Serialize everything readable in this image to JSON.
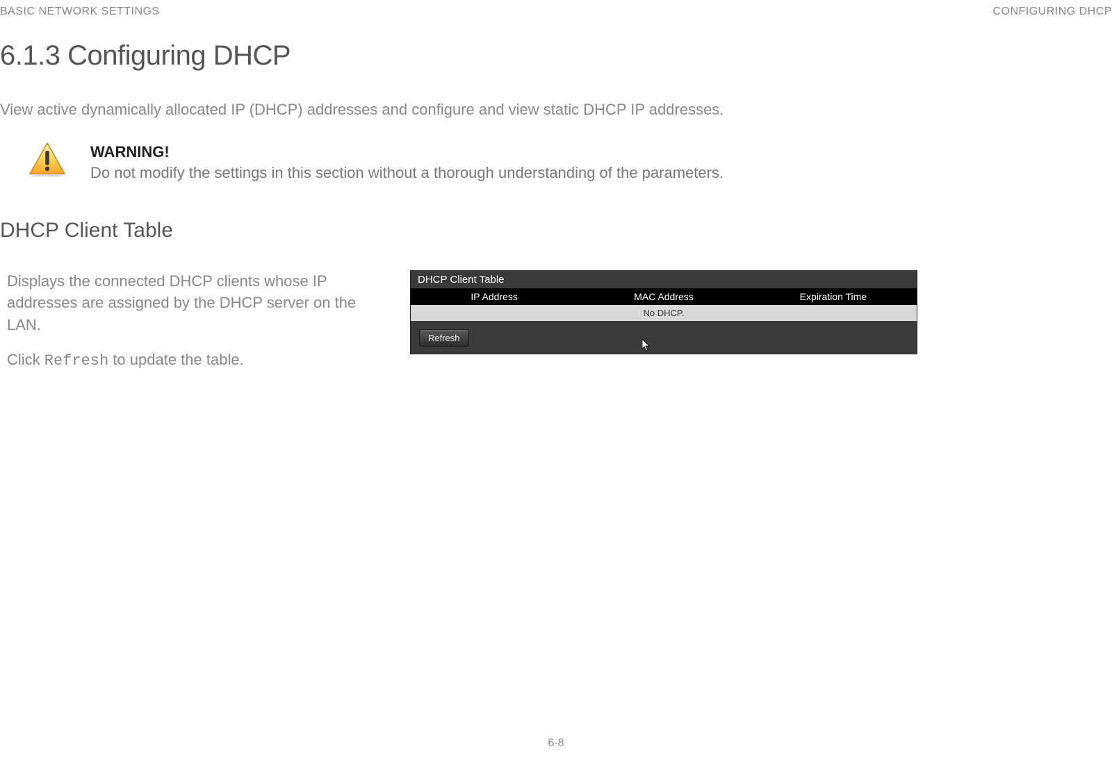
{
  "header": {
    "left": "BASIC NETWORK SETTINGS",
    "right": "CONFIGURING DHCP"
  },
  "section_title": "6.1.3 Configuring DHCP",
  "intro": "View active dynamically allocated IP (DHCP) addresses and configure and view static DHCP IP addresses.",
  "warning": {
    "label": "WARNING!",
    "desc": "Do not modify the settings in this section without a thorough understanding of the parameters."
  },
  "subhead": "DHCP Client Table",
  "left_col": {
    "para1": "Displays the connected DHCP clients whose IP addresses are assigned by the DHCP server on the LAN.",
    "para2_prefix": "Click ",
    "para2_mono": "Refresh",
    "para2_suffix": " to update the table."
  },
  "dhcp_panel": {
    "title": "DHCP Client Table",
    "columns": {
      "c1": "IP Address",
      "c2": "MAC Address",
      "c3": "Expiration Time"
    },
    "empty": "No DHCP.",
    "refresh": "Refresh"
  },
  "page_number": "6-8"
}
